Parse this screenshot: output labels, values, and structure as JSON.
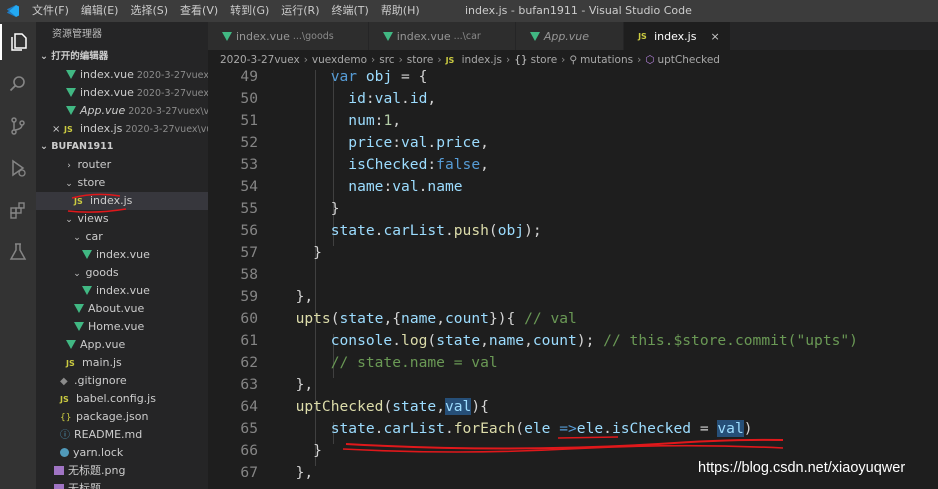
{
  "titlebar": {
    "menu": [
      "文件(F)",
      "编辑(E)",
      "选择(S)",
      "查看(V)",
      "转到(G)",
      "运行(R)",
      "终端(T)",
      "帮助(H)"
    ],
    "window_title": "index.js - bufan1911 - Visual Studio Code"
  },
  "activity_icons": [
    "explorer-icon",
    "search-icon",
    "source-control-icon",
    "run-debug-icon",
    "extensions-icon",
    "test-flask-icon"
  ],
  "sidebar": {
    "title": "资源管理器",
    "open_editors_label": "打开的编辑器",
    "open_editors": [
      {
        "name": "index.vue",
        "path": "2020-3-27vuex\\...",
        "icon": "vue"
      },
      {
        "name": "index.vue",
        "path": "2020-3-27vuex\\...",
        "icon": "vue"
      },
      {
        "name": "App.vue",
        "path": "2020-3-27vuex\\vu...",
        "icon": "vue"
      },
      {
        "name": "index.js",
        "path": "2020-3-27vuex\\vu...",
        "icon": "js",
        "close": "×"
      }
    ],
    "project_label": "BUFAN1911",
    "tree": [
      {
        "name": "router",
        "chev": "›",
        "indent": 28,
        "icon": "none"
      },
      {
        "name": "store",
        "chev": "⌄",
        "indent": 28,
        "icon": "none"
      },
      {
        "name": "index.js",
        "indent": 38,
        "icon": "js",
        "selected": true
      },
      {
        "name": "views",
        "chev": "⌄",
        "indent": 28,
        "icon": "none"
      },
      {
        "name": "car",
        "chev": "⌄",
        "indent": 36,
        "icon": "none"
      },
      {
        "name": "index.vue",
        "indent": 46,
        "icon": "vue"
      },
      {
        "name": "goods",
        "chev": "⌄",
        "indent": 36,
        "icon": "none"
      },
      {
        "name": "index.vue",
        "indent": 46,
        "icon": "vue"
      },
      {
        "name": "About.vue",
        "indent": 38,
        "icon": "vue"
      },
      {
        "name": "Home.vue",
        "indent": 38,
        "icon": "vue"
      },
      {
        "name": "App.vue",
        "indent": 30,
        "icon": "vue"
      },
      {
        "name": "main.js",
        "indent": 30,
        "icon": "js"
      },
      {
        "name": ".gitignore",
        "indent": 24,
        "icon": "git"
      },
      {
        "name": "babel.config.js",
        "indent": 24,
        "icon": "js"
      },
      {
        "name": "package.json",
        "indent": 24,
        "icon": "cfg"
      },
      {
        "name": "README.md",
        "indent": 24,
        "icon": "md"
      },
      {
        "name": "yarn.lock",
        "indent": 24,
        "icon": "yarn"
      },
      {
        "name": "无标题.png",
        "indent": 18,
        "icon": "png"
      },
      {
        "name": "无标题",
        "indent": 18,
        "icon": "png"
      }
    ]
  },
  "tabs": [
    {
      "name": "index.vue",
      "desc": "...\\goods",
      "icon": "vue",
      "active": false,
      "italic": false
    },
    {
      "name": "index.vue",
      "desc": "...\\car",
      "icon": "vue",
      "active": false,
      "italic": false
    },
    {
      "name": "App.vue",
      "desc": "",
      "icon": "vue",
      "active": false,
      "italic": true
    },
    {
      "name": "index.js",
      "desc": "",
      "icon": "js",
      "active": true,
      "italic": false,
      "close": "×"
    }
  ],
  "breadcrumb": [
    "2020-3-27vuex",
    "vuexdemo",
    "src",
    "store",
    "index.js",
    "store",
    "mutations",
    "uptChecked"
  ],
  "code_lines": [
    {
      "n": "49",
      "tokens": [
        [
          "      ",
          "pl"
        ],
        [
          "var",
          "kw"
        ],
        [
          " ",
          "pl"
        ],
        [
          "obj",
          "var"
        ],
        [
          " = {",
          "pl"
        ]
      ]
    },
    {
      "n": "50",
      "tokens": [
        [
          "        ",
          "pl"
        ],
        [
          "id",
          "var"
        ],
        [
          ":",
          "pl"
        ],
        [
          "val",
          "var"
        ],
        [
          ".",
          "pl"
        ],
        [
          "id",
          "var"
        ],
        [
          ",",
          "pl"
        ]
      ]
    },
    {
      "n": "51",
      "tokens": [
        [
          "        ",
          "pl"
        ],
        [
          "num",
          "var"
        ],
        [
          ":",
          "pl"
        ],
        [
          "1",
          "num"
        ],
        [
          ",",
          "pl"
        ]
      ]
    },
    {
      "n": "52",
      "tokens": [
        [
          "        ",
          "pl"
        ],
        [
          "price",
          "var"
        ],
        [
          ":",
          "pl"
        ],
        [
          "val",
          "var"
        ],
        [
          ".",
          "pl"
        ],
        [
          "price",
          "var"
        ],
        [
          ",",
          "pl"
        ]
      ]
    },
    {
      "n": "53",
      "tokens": [
        [
          "        ",
          "pl"
        ],
        [
          "isChecked",
          "var"
        ],
        [
          ":",
          "pl"
        ],
        [
          "false",
          "kw"
        ],
        [
          ",",
          "pl"
        ]
      ]
    },
    {
      "n": "54",
      "tokens": [
        [
          "        ",
          "pl"
        ],
        [
          "name",
          "var"
        ],
        [
          ":",
          "pl"
        ],
        [
          "val",
          "var"
        ],
        [
          ".",
          "pl"
        ],
        [
          "name",
          "var"
        ]
      ]
    },
    {
      "n": "55",
      "tokens": [
        [
          "      }",
          "pl"
        ]
      ]
    },
    {
      "n": "56",
      "tokens": [
        [
          "      ",
          "pl"
        ],
        [
          "state",
          "var"
        ],
        [
          ".",
          "pl"
        ],
        [
          "carList",
          "var"
        ],
        [
          ".",
          "pl"
        ],
        [
          "push",
          "fn"
        ],
        [
          "(",
          "pl"
        ],
        [
          "obj",
          "var"
        ],
        [
          ");",
          "pl"
        ]
      ]
    },
    {
      "n": "57",
      "tokens": [
        [
          "    }",
          "pl"
        ]
      ]
    },
    {
      "n": "58",
      "tokens": []
    },
    {
      "n": "59",
      "tokens": [
        [
          "  },",
          "pl"
        ]
      ]
    },
    {
      "n": "60",
      "tokens": [
        [
          "  ",
          "pl"
        ],
        [
          "upts",
          "fn"
        ],
        [
          "(",
          "pl"
        ],
        [
          "state",
          "var"
        ],
        [
          ",{",
          "pl"
        ],
        [
          "name",
          "var"
        ],
        [
          ",",
          "pl"
        ],
        [
          "count",
          "var"
        ],
        [
          "}){ ",
          "pl"
        ],
        [
          "// val",
          "cm"
        ]
      ]
    },
    {
      "n": "61",
      "tokens": [
        [
          "      ",
          "pl"
        ],
        [
          "console",
          "var"
        ],
        [
          ".",
          "pl"
        ],
        [
          "log",
          "fn"
        ],
        [
          "(",
          "pl"
        ],
        [
          "state",
          "var"
        ],
        [
          ",",
          "pl"
        ],
        [
          "name",
          "var"
        ],
        [
          ",",
          "pl"
        ],
        [
          "count",
          "var"
        ],
        [
          "); ",
          "pl"
        ],
        [
          "// this.$store.commit(\"upts\")",
          "cm"
        ]
      ]
    },
    {
      "n": "62",
      "tokens": [
        [
          "      ",
          "pl"
        ],
        [
          "// state.name = val",
          "cm"
        ]
      ]
    },
    {
      "n": "63",
      "tokens": [
        [
          "  },",
          "pl"
        ]
      ]
    },
    {
      "n": "64",
      "tokens": [
        [
          "  ",
          "pl"
        ],
        [
          "uptChecked",
          "fn"
        ],
        [
          "(",
          "pl"
        ],
        [
          "state",
          "var"
        ],
        [
          ",",
          "pl"
        ],
        [
          "val",
          "var",
          "hl"
        ],
        [
          "){",
          "pl"
        ]
      ]
    },
    {
      "n": "65",
      "tokens": [
        [
          "      ",
          "pl"
        ],
        [
          "state",
          "var"
        ],
        [
          ".",
          "pl"
        ],
        [
          "carList",
          "var"
        ],
        [
          ".",
          "pl"
        ],
        [
          "forEach",
          "fn"
        ],
        [
          "(",
          "pl"
        ],
        [
          "ele",
          "var"
        ],
        [
          " =>",
          "kw"
        ],
        [
          "ele",
          "var"
        ],
        [
          ".",
          "pl"
        ],
        [
          "isChecked",
          "var"
        ],
        [
          " = ",
          "pl"
        ],
        [
          "val",
          "var",
          "hl"
        ],
        [
          ")",
          "pl"
        ]
      ]
    },
    {
      "n": "66",
      "tokens": [
        [
          "    }",
          "pl"
        ]
      ]
    },
    {
      "n": "67",
      "tokens": [
        [
          "  },",
          "pl"
        ]
      ]
    }
  ],
  "watermark": "https://blog.csdn.net/xiaoyuqwer",
  "colors": {
    "accent_vue": "#41b883",
    "js_yellow": "#cbcb41",
    "annotation_red": "#e0181b"
  }
}
